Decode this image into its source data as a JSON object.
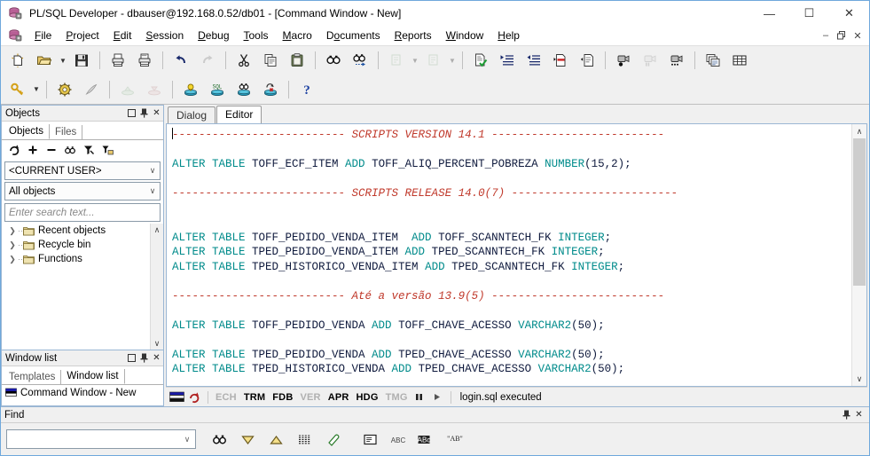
{
  "window": {
    "title": "PL/SQL Developer - dbauser@192.168.0.52/db01 - [Command Window - New]",
    "app_icon": "database-icon",
    "minimize": "—",
    "maximize": "☐",
    "close": "✕",
    "mdi_restore": "❐",
    "mdi_minimize": "–",
    "mdi_close": "✕"
  },
  "menu": {
    "icon": "mdi-database-icon",
    "items": [
      {
        "label": "File",
        "accel": "F"
      },
      {
        "label": "Project",
        "accel": "P"
      },
      {
        "label": "Edit",
        "accel": "E"
      },
      {
        "label": "Session",
        "accel": "S"
      },
      {
        "label": "Debug",
        "accel": "D"
      },
      {
        "label": "Tools",
        "accel": "T"
      },
      {
        "label": "Macro",
        "accel": "M"
      },
      {
        "label": "Documents",
        "accel": "o"
      },
      {
        "label": "Reports",
        "accel": "R"
      },
      {
        "label": "Window",
        "accel": "W"
      },
      {
        "label": "Help",
        "accel": "H"
      }
    ]
  },
  "toolbar1": [
    {
      "name": "new-icon",
      "enabled": true
    },
    {
      "name": "open-folder-icon",
      "enabled": true,
      "dropdown": true
    },
    {
      "name": "save-icon",
      "enabled": true
    },
    {
      "name": "separator"
    },
    {
      "name": "print-icon",
      "enabled": true
    },
    {
      "name": "print-preview-icon",
      "enabled": true
    },
    {
      "name": "separator"
    },
    {
      "name": "undo-icon",
      "enabled": true
    },
    {
      "name": "redo-icon",
      "enabled": false
    },
    {
      "name": "separator"
    },
    {
      "name": "cut-icon",
      "enabled": true
    },
    {
      "name": "copy-icon",
      "enabled": true
    },
    {
      "name": "paste-icon",
      "enabled": true
    },
    {
      "name": "separator"
    },
    {
      "name": "find-icon",
      "enabled": true
    },
    {
      "name": "find-next-icon",
      "enabled": true
    },
    {
      "name": "separator"
    },
    {
      "name": "previous-window-icon",
      "enabled": false,
      "dropdown": true
    },
    {
      "name": "next-window-icon",
      "enabled": false,
      "dropdown": true
    },
    {
      "name": "separator"
    },
    {
      "name": "check-syntax-icon",
      "enabled": true
    },
    {
      "name": "indent-icon",
      "enabled": true
    },
    {
      "name": "unindent-icon",
      "enabled": true
    },
    {
      "name": "comment-icon",
      "enabled": true
    },
    {
      "name": "uncomment-icon",
      "enabled": true
    },
    {
      "name": "separator"
    },
    {
      "name": "record-macro-icon",
      "enabled": true
    },
    {
      "name": "pause-macro-icon",
      "enabled": false
    },
    {
      "name": "play-macro-icon",
      "enabled": true
    },
    {
      "name": "separator"
    },
    {
      "name": "window-list-icon",
      "enabled": true
    },
    {
      "name": "grid-icon",
      "enabled": true
    }
  ],
  "toolbar2": [
    {
      "name": "key-logon-icon",
      "enabled": true,
      "dropdown": true
    },
    {
      "name": "separator"
    },
    {
      "name": "session-settings-icon",
      "enabled": true
    },
    {
      "name": "break-icon",
      "enabled": true
    },
    {
      "name": "separator"
    },
    {
      "name": "commit-icon",
      "enabled": false
    },
    {
      "name": "rollback-icon",
      "enabled": false
    },
    {
      "name": "separator"
    },
    {
      "name": "explain-plan-icon",
      "enabled": true
    },
    {
      "name": "sql-window-icon",
      "enabled": true
    },
    {
      "name": "find-database-icon",
      "enabled": true
    },
    {
      "name": "recompile-icon",
      "enabled": true
    },
    {
      "name": "separator"
    },
    {
      "name": "help-icon",
      "enabled": true
    }
  ],
  "objects_panel": {
    "header_title": "Objects",
    "header_buttons": [
      "maximize-icon",
      "pin-icon",
      "close-icon"
    ],
    "tabs": [
      {
        "label": "Objects",
        "active": true
      },
      {
        "label": "Files",
        "active": false
      }
    ],
    "tools": [
      "refresh-icon",
      "expand-icon",
      "collapse-icon",
      "find-icon",
      "filter-icon",
      "folder-filter-icon"
    ],
    "user_combo": "<CURRENT USER>",
    "filter_combo": "All objects",
    "search_placeholder": "Enter search text...",
    "tree_items": [
      {
        "label": "Recent objects",
        "icon": "folder-icon"
      },
      {
        "label": "Recycle bin",
        "icon": "folder-icon"
      },
      {
        "label": "Functions",
        "icon": "folder-icon"
      }
    ],
    "scroll_up": "∧",
    "scroll_down": "∨"
  },
  "window_list_panel": {
    "header_title": "Window list",
    "header_buttons": [
      "maximize-icon",
      "pin-icon",
      "close-icon"
    ],
    "tabs": [
      {
        "label": "Templates",
        "active": false
      },
      {
        "label": "Window list",
        "active": true
      }
    ],
    "items": [
      {
        "label": "Command Window - New",
        "icon": "command-window-icon"
      }
    ]
  },
  "editor": {
    "tabs": [
      {
        "label": "Dialog",
        "active": false
      },
      {
        "label": "Editor",
        "active": true
      }
    ],
    "lines": [
      [
        {
          "t": "caret",
          "text": ""
        },
        {
          "t": "cm-plain",
          "text": "-------------------------- "
        },
        {
          "t": "cm",
          "text": "SCRIPTS VERSION 14.1"
        },
        {
          "t": "cm-plain",
          "text": " --------------------------"
        }
      ],
      [],
      [
        {
          "t": "kw",
          "text": "ALTER TABLE "
        },
        {
          "t": "id",
          "text": "TOFF_ECF_ITEM "
        },
        {
          "t": "kw",
          "text": "ADD "
        },
        {
          "t": "id",
          "text": "TOFF_ALIQ_PERCENT_POBREZA "
        },
        {
          "t": "kw",
          "text": "NUMBER"
        },
        {
          "t": "id",
          "text": "(15,2);"
        }
      ],
      [],
      [
        {
          "t": "cm-plain",
          "text": "-------------------------- "
        },
        {
          "t": "cm",
          "text": "SCRIPTS RELEASE 14.0(7)"
        },
        {
          "t": "cm-plain",
          "text": " -------------------------"
        }
      ],
      [],
      [],
      [
        {
          "t": "kw",
          "text": "ALTER TABLE "
        },
        {
          "t": "id",
          "text": "TOFF_PEDIDO_VENDA_ITEM  "
        },
        {
          "t": "kw",
          "text": "ADD "
        },
        {
          "t": "id",
          "text": "TOFF_SCANNTECH_FK "
        },
        {
          "t": "kw",
          "text": "INTEGER"
        },
        {
          "t": "id",
          "text": ";"
        }
      ],
      [
        {
          "t": "kw",
          "text": "ALTER TABLE "
        },
        {
          "t": "id",
          "text": "TPED_PEDIDO_VENDA_ITEM "
        },
        {
          "t": "kw",
          "text": "ADD "
        },
        {
          "t": "id",
          "text": "TPED_SCANNTECH_FK "
        },
        {
          "t": "kw",
          "text": "INTEGER"
        },
        {
          "t": "id",
          "text": ";"
        }
      ],
      [
        {
          "t": "kw",
          "text": "ALTER TABLE "
        },
        {
          "t": "id",
          "text": "TPED_HISTORICO_VENDA_ITEM "
        },
        {
          "t": "kw",
          "text": "ADD "
        },
        {
          "t": "id",
          "text": "TPED_SCANNTECH_FK "
        },
        {
          "t": "kw",
          "text": "INTEGER"
        },
        {
          "t": "id",
          "text": ";"
        }
      ],
      [],
      [
        {
          "t": "cm-plain",
          "text": "-------------------------- "
        },
        {
          "t": "cm",
          "text": "Até a versão 13.9(5)"
        },
        {
          "t": "cm-plain",
          "text": " --------------------------"
        }
      ],
      [],
      [
        {
          "t": "kw",
          "text": "ALTER TABLE "
        },
        {
          "t": "id",
          "text": "TOFF_PEDIDO_VENDA "
        },
        {
          "t": "kw",
          "text": "ADD "
        },
        {
          "t": "id",
          "text": "TOFF_CHAVE_ACESSO "
        },
        {
          "t": "kw",
          "text": "VARCHAR2"
        },
        {
          "t": "id",
          "text": "(50);"
        }
      ],
      [],
      [
        {
          "t": "kw",
          "text": "ALTER TABLE "
        },
        {
          "t": "id",
          "text": "TPED_PEDIDO_VENDA "
        },
        {
          "t": "kw",
          "text": "ADD "
        },
        {
          "t": "id",
          "text": "TPED_CHAVE_ACESSO "
        },
        {
          "t": "kw",
          "text": "VARCHAR2"
        },
        {
          "t": "id",
          "text": "(50);"
        }
      ],
      [
        {
          "t": "kw",
          "text": "ALTER TABLE "
        },
        {
          "t": "id",
          "text": "TPED_HISTORICO_VENDA "
        },
        {
          "t": "kw",
          "text": "ADD "
        },
        {
          "t": "id",
          "text": "TPED_CHAVE_ACESSO "
        },
        {
          "t": "kw",
          "text": "VARCHAR2"
        },
        {
          "t": "id",
          "text": "(50);"
        }
      ]
    ],
    "scroll_up": "∧",
    "scroll_down": "∨"
  },
  "status": {
    "connection_icon": "connection-bars-icon",
    "rollback_icon": "session-rollback-icon",
    "flags": [
      {
        "label": "ECH",
        "on": false
      },
      {
        "label": "TRM",
        "on": true
      },
      {
        "label": "FDB",
        "on": true
      },
      {
        "label": "VER",
        "on": false
      },
      {
        "label": "APR",
        "on": true
      },
      {
        "label": "HDG",
        "on": true
      },
      {
        "label": "TMG",
        "on": false
      }
    ],
    "pause_icon": "pause-icon",
    "play_icon": "play-icon",
    "message": "login.sql executed"
  },
  "find_panel": {
    "header_title": "Find",
    "header_buttons": [
      "pin-icon",
      "close-icon"
    ],
    "input_value": "",
    "input_arrow": "∨",
    "buttons": [
      {
        "name": "find-icon"
      },
      {
        "name": "find-down-icon"
      },
      {
        "name": "find-up-icon"
      },
      {
        "name": "find-all-icon"
      },
      {
        "name": "clear-highlight-icon"
      },
      {
        "name": "gap"
      },
      {
        "name": "find-in-window-icon"
      },
      {
        "name": "match-case-off-icon"
      },
      {
        "name": "match-case-on-icon"
      },
      {
        "name": "whole-word-icon"
      }
    ]
  },
  "colors": {
    "keyword": "#008b8b",
    "identifier": "#0f1a3d",
    "comment": "#c0392b",
    "window_border": "#6fa8dc",
    "chrome": "#f0f0f0"
  }
}
